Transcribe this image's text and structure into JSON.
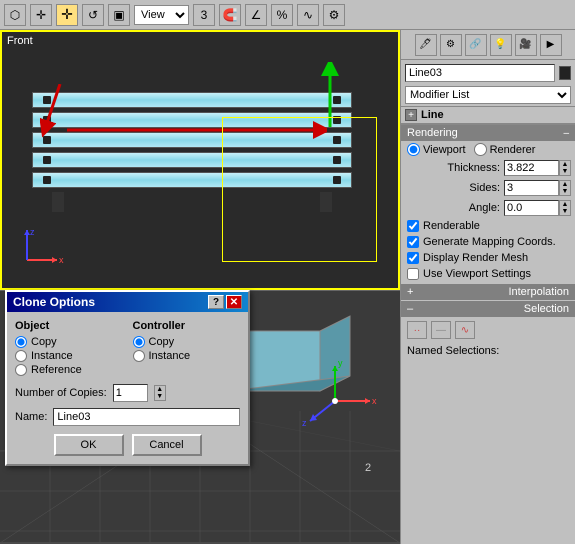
{
  "toolbar": {
    "view_dropdown": "View",
    "icons": [
      "⬡",
      "✛",
      "↺",
      "▣",
      "3",
      "⟳",
      "%",
      "∿"
    ]
  },
  "viewport_front": {
    "label": "Front"
  },
  "right_panel": {
    "object_name": "Line03",
    "modifier_list_label": "Modifier List",
    "line_label": "Line",
    "rendering_label": "Rendering",
    "viewport_label": "Viewport",
    "renderer_label": "Renderer",
    "thickness_label": "Thickness:",
    "thickness_value": "3.822",
    "sides_label": "Sides:",
    "sides_value": "3",
    "angle_label": "Angle:",
    "angle_value": "0.0",
    "renderable_label": "Renderable",
    "gen_mapping_label": "Generate Mapping Coords.",
    "display_render_mesh_label": "Display Render Mesh",
    "use_viewport_label": "Use Viewport Settings",
    "interpolation_label": "Interpolation",
    "selection_label": "Selection",
    "named_selections_label": "Named Selections:"
  },
  "clone_dialog": {
    "title": "Clone Options",
    "object_group_label": "Object",
    "controller_group_label": "Controller",
    "copy_label": "Copy",
    "instance_label": "Instance",
    "reference_label": "Reference",
    "controller_copy_label": "Copy",
    "controller_instance_label": "Instance",
    "copies_label": "Number of Copies:",
    "copies_value": "1",
    "name_label": "Name:",
    "name_value": "Line03",
    "ok_label": "OK",
    "cancel_label": "Cancel",
    "help_btn": "?",
    "close_btn": "✕"
  }
}
